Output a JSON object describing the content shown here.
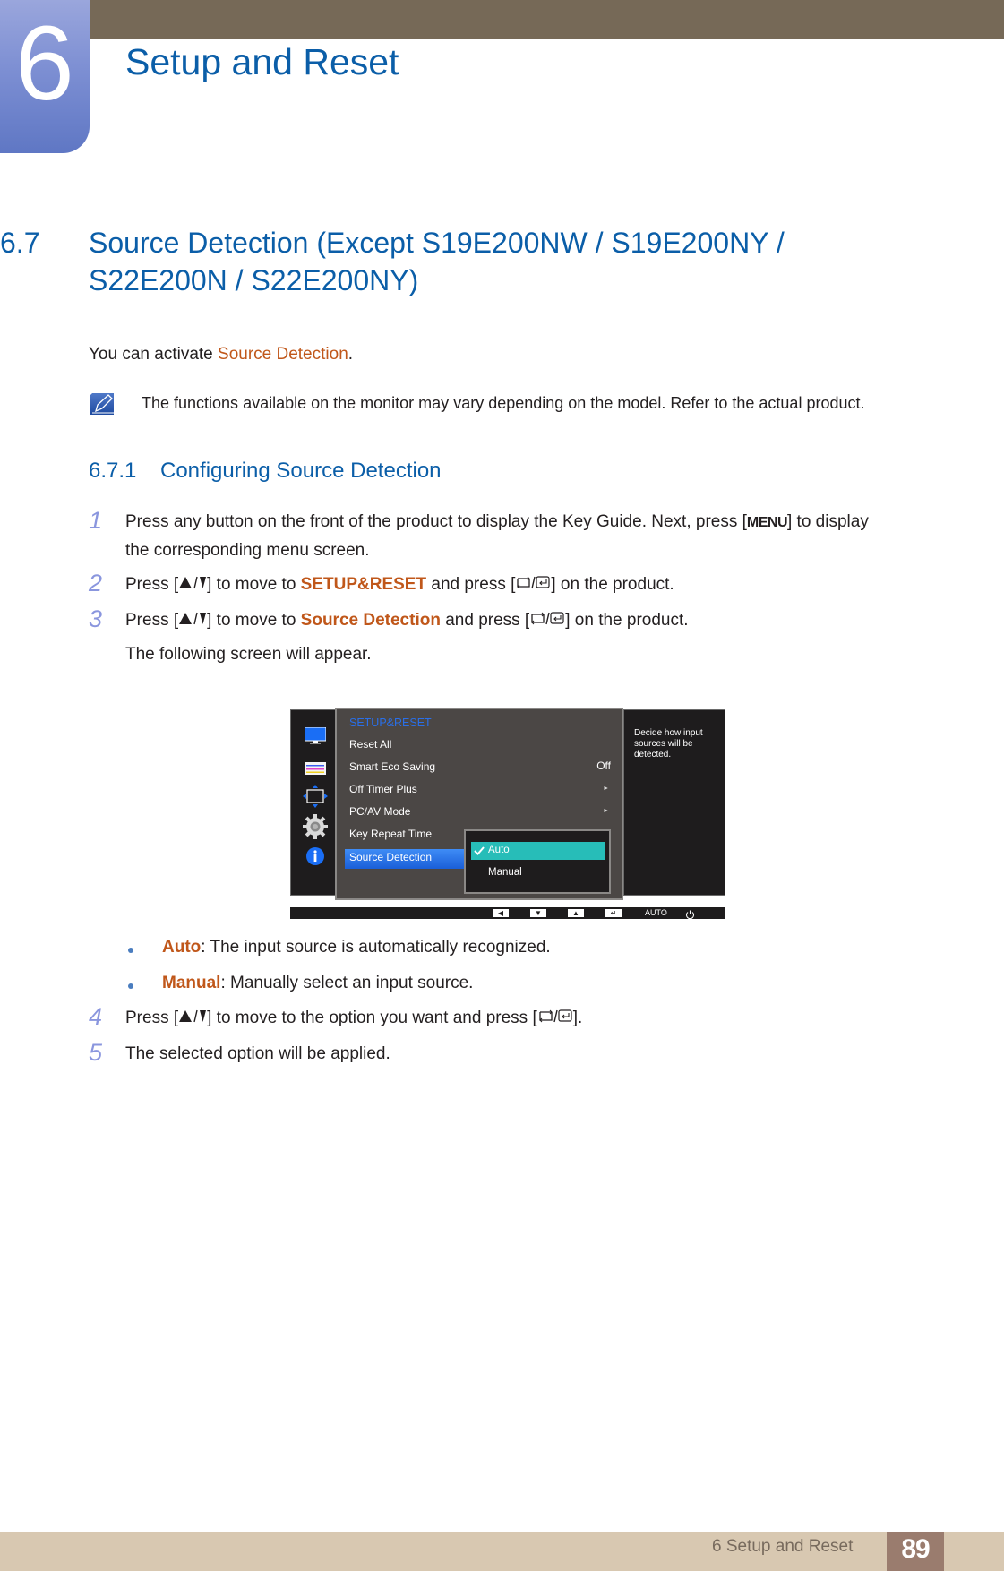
{
  "chapter": {
    "number": "6",
    "title": "Setup and Reset"
  },
  "section": {
    "number": "6.7",
    "title": "Source Detection (Except S19E200NW / S19E200NY / S22E200N / S22E200NY)",
    "title_line1": "Source Detection (Except S19E200NW / S19E200NY /",
    "title_line2": "S22E200N / S22E200NY)"
  },
  "intro": {
    "prefix": "You can activate ",
    "highlight": "Source Detection",
    "suffix": "."
  },
  "note": {
    "icon": "note-pencil-icon",
    "text": "The functions available on the monitor may vary depending on the model. Refer to the actual product."
  },
  "subsection": {
    "number": "6.7.1",
    "title": "Configuring Source Detection"
  },
  "steps": [
    {
      "num": "1",
      "line1_a": "Press any button on the front of the product to display the Key Guide. Next, press [",
      "key": "MENU",
      "line1_b": "] to display",
      "line2": "the corresponding menu screen."
    },
    {
      "num": "2",
      "a": "Press [",
      "b": "] to move to ",
      "highlight": "SETUP&RESET",
      "c": " and press [",
      "d": "] on the product."
    },
    {
      "num": "3",
      "a": "Press [",
      "b": "] to move to ",
      "highlight": "Source Detection",
      "c": " and press [",
      "d": "] on the product.",
      "after": "The following screen will appear."
    },
    {
      "num": "4",
      "a": "Press [",
      "b": "] to move to the option you want and press [",
      "d": "]."
    },
    {
      "num": "5",
      "text": "The selected option will be applied."
    }
  ],
  "options": [
    {
      "name": "Auto",
      "desc": ": The input source is automatically recognized."
    },
    {
      "name": "Manual",
      "desc": ": Manually select an input source."
    }
  ],
  "osd": {
    "sidebar_icons": [
      "monitor-icon",
      "color-icon",
      "size-position-icon",
      "settings-gear-icon",
      "info-icon"
    ],
    "menu_title": "SETUP&RESET",
    "items": [
      {
        "label": "Reset All",
        "value": ""
      },
      {
        "label": "Smart Eco Saving",
        "value": "Off"
      },
      {
        "label": "Off Timer Plus",
        "value": "►"
      },
      {
        "label": "PC/AV Mode",
        "value": "►"
      },
      {
        "label": "Key Repeat Time",
        "value": ""
      },
      {
        "label": "Source Detection",
        "value": ""
      }
    ],
    "selected_item": "Source Detection",
    "popup_options": [
      "Auto",
      "Manual"
    ],
    "popup_selected": "Auto",
    "help_text": "Decide how input sources will be detected.",
    "keybar": {
      "buttons": [
        "left-arrow",
        "down-arrow",
        "up-arrow",
        "enter"
      ],
      "auto_label": "AUTO",
      "power_icon": "power-icon"
    },
    "colors": {
      "title": "#2a6fe8",
      "selected": "#1a5fd8",
      "popup_selected": "#27bdb8"
    }
  },
  "footer": {
    "text": "6 Setup and Reset",
    "page": "89"
  },
  "colors": {
    "heading_blue": "#0b5ea8",
    "highlight_orange": "#c0571a",
    "step_number": "#8a96de",
    "top_band": "#766957",
    "footer_band": "#d8c8b1",
    "page_box": "#9a7c6e"
  }
}
